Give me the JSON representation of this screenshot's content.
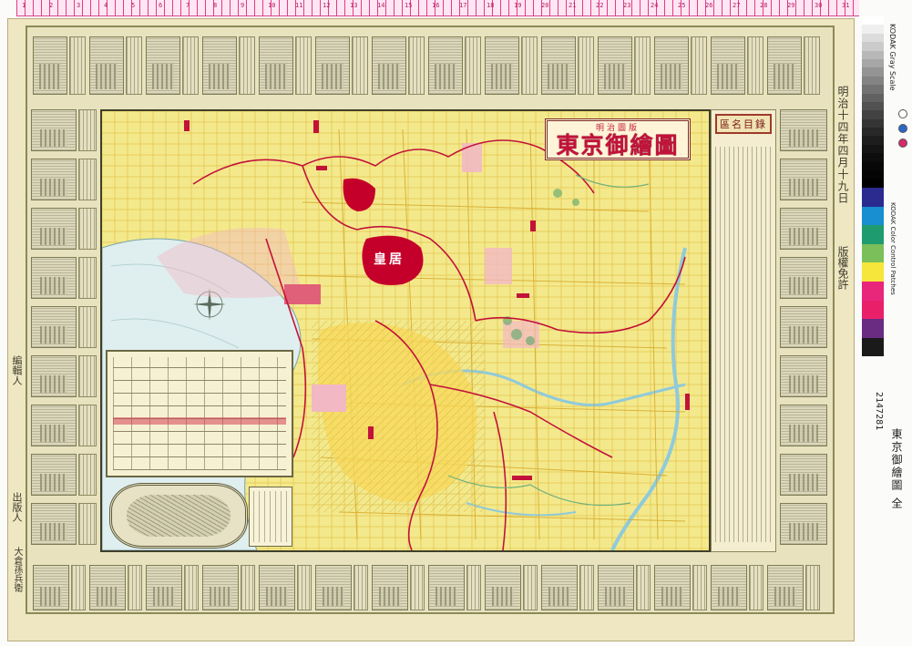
{
  "ruler": {
    "ticks": [
      "1",
      "2",
      "3",
      "4",
      "5",
      "6",
      "7",
      "8",
      "9",
      "10",
      "11",
      "12",
      "13",
      "14",
      "15",
      "16",
      "17",
      "18",
      "19",
      "20",
      "21",
      "22",
      "23",
      "24",
      "25",
      "26",
      "27",
      "28",
      "29",
      "30",
      "31"
    ]
  },
  "map": {
    "title_sub": "明治圖版",
    "title": "東京御繪圖",
    "index_heading": "區名目錄",
    "palace_label": "皇居",
    "colors": {
      "land": "#f3e98c",
      "water": "#d9ecec",
      "river": "#9bd3dd",
      "roads": "#e8c637",
      "boundary": "#c2123a",
      "district": "#f2b8c4",
      "palace": "#c4002a",
      "green": "#5aa56b"
    }
  },
  "imprint": {
    "date": "明治十四年四月十九日",
    "permission": "版權免許",
    "editor": "編輯人",
    "publisher": "出版人",
    "shop": "大倉孫兵衛"
  },
  "catalog": {
    "id": "2147281",
    "title": "東京御繪圖",
    "title_suffix": "全"
  },
  "control_strips": {
    "gray_label": "KODAK Gray Scale",
    "color_label": "KODAK Color Control Patches",
    "gray_levels": [
      "#ffffff",
      "#efefef",
      "#dcdcdc",
      "#cbcbcb",
      "#b8b8b8",
      "#a6a6a6",
      "#949494",
      "#838383",
      "#727272",
      "#616161",
      "#515151",
      "#424242",
      "#353535",
      "#282828",
      "#1d1d1d",
      "#141414",
      "#0d0d0d",
      "#080808",
      "#050505",
      "#000000"
    ],
    "color_patches": [
      "#2a2a8f",
      "#178fd0",
      "#1f9c6f",
      "#7abf59",
      "#f6e53a",
      "#e8267a",
      "#ea1f6a",
      "#6a2b83",
      "#1a1a1a"
    ],
    "dot_colors": [
      "#ffffff",
      "#2a67c9",
      "#d42a6a"
    ]
  }
}
